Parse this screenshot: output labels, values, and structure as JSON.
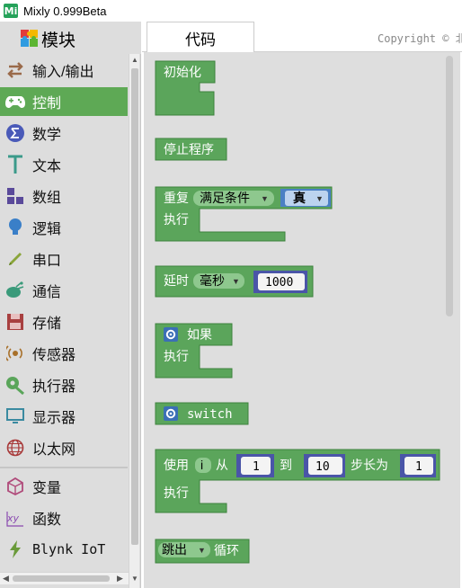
{
  "window": {
    "title": "Mixly 0.999Beta",
    "app_icon": "Mi"
  },
  "sidebar": {
    "header": "模块",
    "items": [
      {
        "label": "输入/输出",
        "icon": "arrows-swap-icon"
      },
      {
        "label": "控制",
        "icon": "gamepad-icon",
        "selected": true
      },
      {
        "label": "数学",
        "icon": "sigma-icon"
      },
      {
        "label": "文本",
        "icon": "text-t-icon"
      },
      {
        "label": "数组",
        "icon": "blocks-icon"
      },
      {
        "label": "逻辑",
        "icon": "bulb-icon"
      },
      {
        "label": "串口",
        "icon": "pen-icon"
      },
      {
        "label": "通信",
        "icon": "satellite-icon"
      },
      {
        "label": "存储",
        "icon": "floppy-icon"
      },
      {
        "label": "传感器",
        "icon": "sensor-icon"
      },
      {
        "label": "执行器",
        "icon": "actuator-icon"
      },
      {
        "label": "显示器",
        "icon": "monitor-icon"
      },
      {
        "label": "以太网",
        "icon": "globe-icon"
      },
      {
        "label": "变量",
        "icon": "variable-icon"
      },
      {
        "label": "函数",
        "icon": "function-icon"
      },
      {
        "label": "Blynk IoT",
        "icon": "lightning-icon"
      }
    ]
  },
  "tabs": {
    "code": "代码"
  },
  "copyright": "Copyright © 北",
  "blocks": {
    "init": {
      "label": "初始化"
    },
    "stop": {
      "label": "停止程序"
    },
    "repeat": {
      "label": "重复",
      "mode": "满足条件",
      "cond": "真",
      "do": "执行"
    },
    "delay": {
      "label": "延时",
      "unit": "毫秒",
      "value": "1000"
    },
    "if": {
      "label": "如果",
      "do": "执行"
    },
    "switch": {
      "label": "switch"
    },
    "for": {
      "label": "使用",
      "var": "i",
      "from": "从",
      "from_val": "1",
      "to": "到",
      "to_val": "10",
      "step": "步长为",
      "step_val": "1",
      "do": "执行"
    },
    "break": {
      "mode": "跳出",
      "label": "循环"
    }
  },
  "colors": {
    "block": "#5ba55b",
    "block_dark": "#3d823d",
    "selected": "#5ea955",
    "gear": "#3b6fb6"
  }
}
